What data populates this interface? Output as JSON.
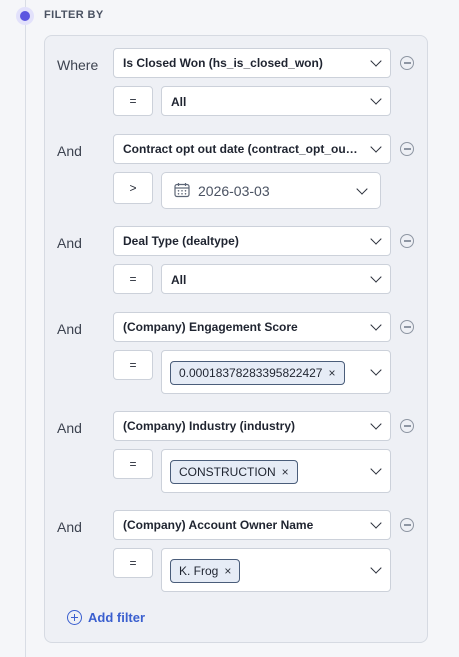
{
  "header": {
    "title": "FILTER BY"
  },
  "filters": [
    {
      "conj": "Where",
      "field": "Is Closed Won (hs_is_closed_won)",
      "op": "=",
      "value": "All",
      "value_kind": "select"
    },
    {
      "conj": "And",
      "field": "Contract opt out date (contract_opt_out_...",
      "op": ">",
      "value": "2026-03-03",
      "value_kind": "date"
    },
    {
      "conj": "And",
      "field": "Deal Type (dealtype)",
      "op": "=",
      "value": "All",
      "value_kind": "select"
    },
    {
      "conj": "And",
      "field": "(Company) Engagement Score",
      "op": "=",
      "value": "0.00018378283395822427",
      "value_kind": "tag"
    },
    {
      "conj": "And",
      "field": "(Company) Industry (industry)",
      "op": "=",
      "value": "CONSTRUCTION",
      "value_kind": "tag"
    },
    {
      "conj": "And",
      "field": "(Company) Account Owner Name",
      "op": "=",
      "value": "K. Frog",
      "value_kind": "tag"
    }
  ],
  "add_filter": {
    "label": "Add filter"
  },
  "tag_remove_glyph": "×",
  "colors": {
    "accent": "#5b55e0",
    "link": "#3a5fcf"
  }
}
